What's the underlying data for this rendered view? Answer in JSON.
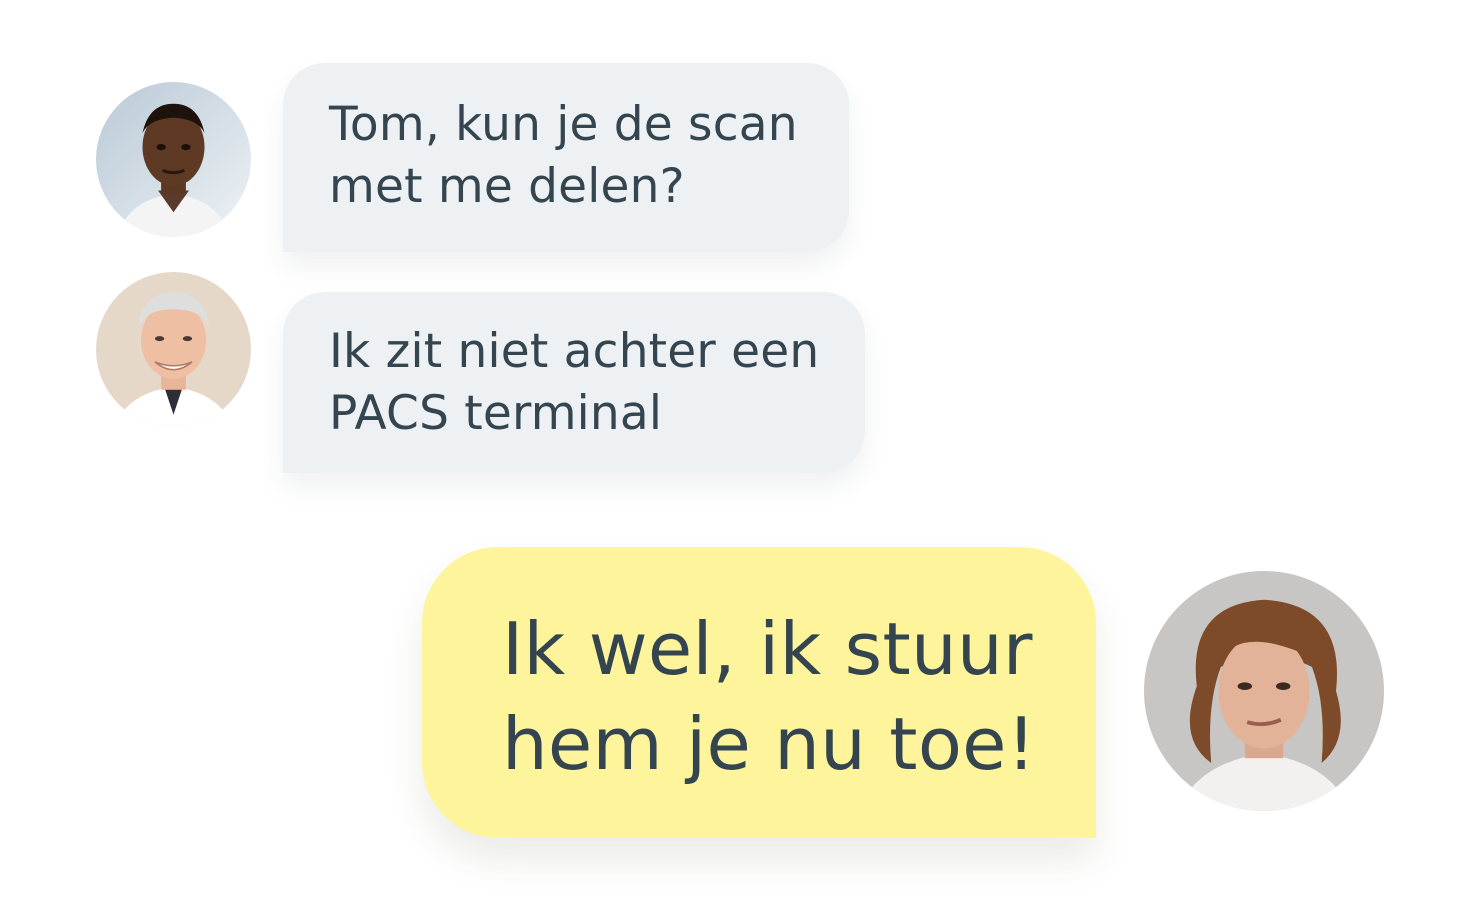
{
  "conversation": {
    "messages": [
      {
        "sender": "colleague-1",
        "direction": "incoming",
        "text": "Tom, kun je de scan\nmet me delen?"
      },
      {
        "sender": "colleague-2",
        "direction": "incoming",
        "text": "Ik zit niet achter een\nPACS terminal"
      },
      {
        "sender": "tom",
        "direction": "outgoing",
        "text": "Ik wel, ik stuur\nhem je nu toe!"
      }
    ]
  },
  "colors": {
    "incoming_bubble": "#edf1f4",
    "outgoing_bubble": "#fdf49c",
    "text": "#34454f"
  }
}
